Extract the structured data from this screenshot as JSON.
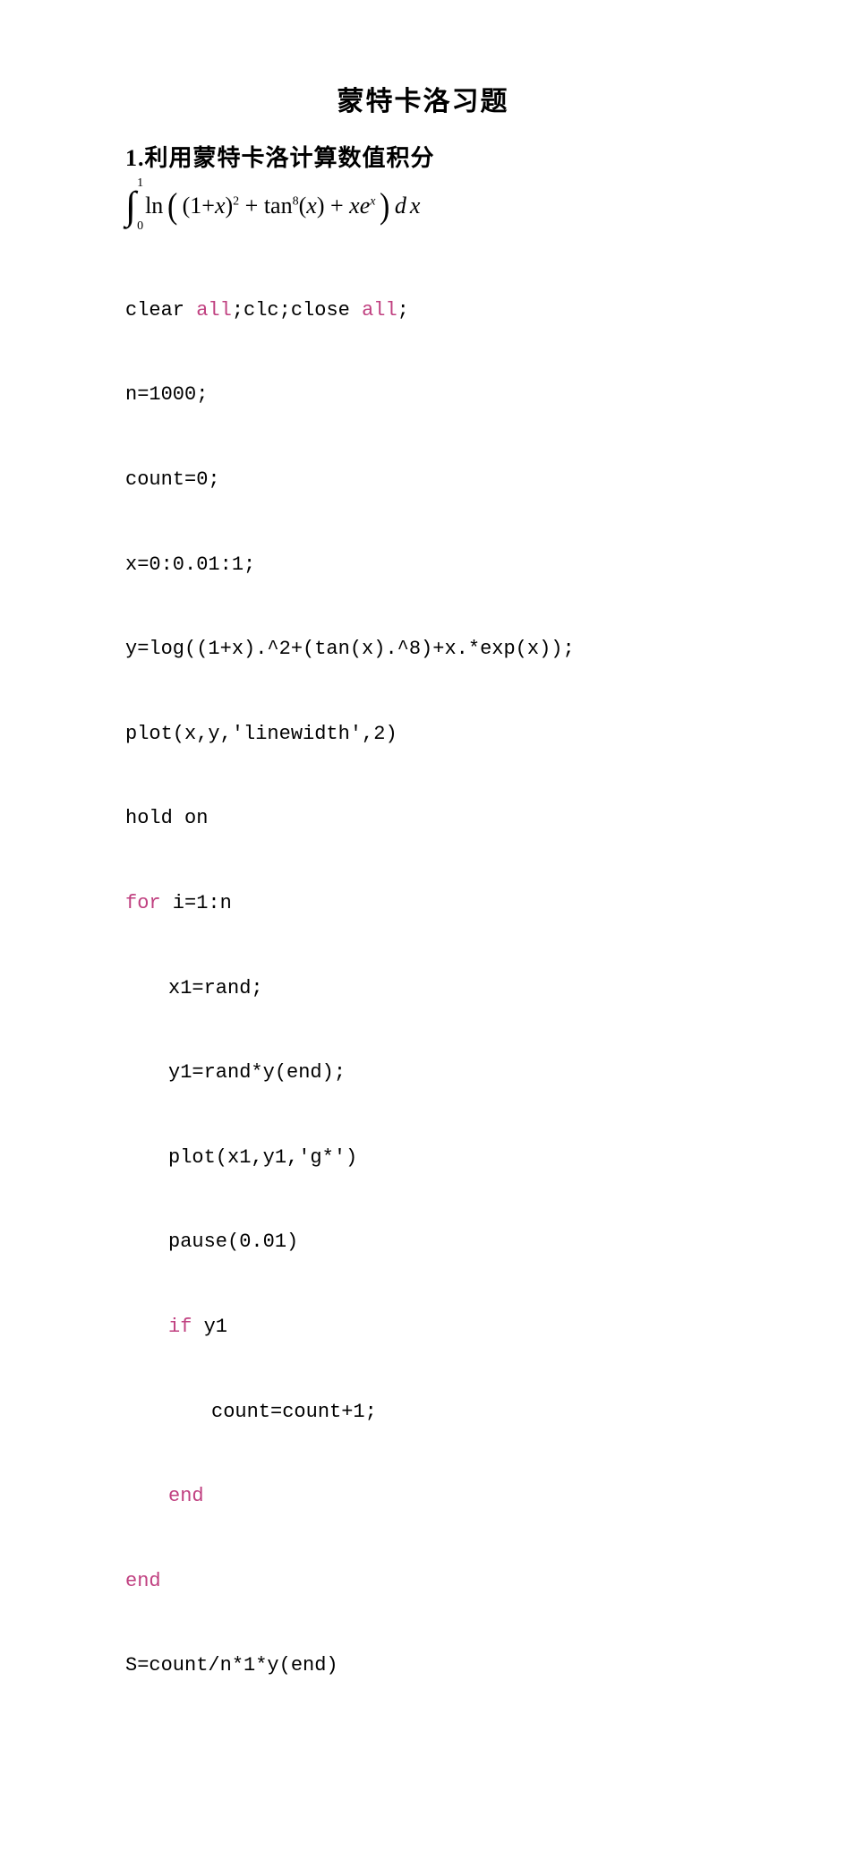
{
  "title": "蒙特卡洛习题",
  "subtitle": "1.利用蒙特卡洛计算数值积分",
  "integral": {
    "upper": "1",
    "lower": "0",
    "ln": "ln",
    "expr_a": "(1+",
    "expr_x1": "x",
    "expr_a2": ")",
    "exp1": "2",
    "plus1": " + tan",
    "exp2": "8",
    "paren_x": "(",
    "x_in": "x",
    "paren_x2": ")",
    "plus2": " + ",
    "x2": "x",
    "e": "e",
    "exp3": "x",
    "dx_d": "d",
    "dx_x": "x"
  },
  "code": {
    "l1a": "clear ",
    "l1b": "all",
    "l1c": ";clc;close ",
    "l1d": "all",
    "l1e": ";",
    "l2": "n=1000;",
    "l3": "count=0;",
    "l4": "x=0:0.01:1;",
    "l5": "y=log((1+x).^2+(tan(x).^8)+x.*exp(x));",
    "l6": "plot(x,y,'linewidth',2)",
    "l7": "hold on",
    "l8a": "for",
    "l8b": " i=1:n",
    "l9": "x1=rand;",
    "l10": "y1=rand*y(end);",
    "l11": "plot(x1,y1,'g*')",
    "l12": "pause(0.01)",
    "l13a": "if",
    "l13b": " y1",
    "l14": "count=count+1;",
    "l15": "end",
    "l16": "end",
    "l17": "S=count/n*1*y(end)"
  }
}
